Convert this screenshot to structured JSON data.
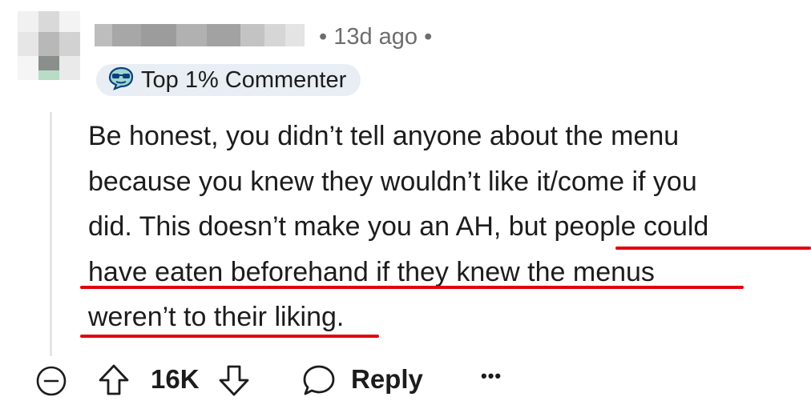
{
  "comment": {
    "timestamp": "13d ago",
    "meta_separator": "•",
    "flair": {
      "icon": "sunglasses-emoji-icon",
      "label": "Top 1% Commenter"
    },
    "body_lines": [
      "Be honest, you didn’t tell anyone about the menu",
      "because you knew they wouldn’t like it/come if you",
      "did. This doesn’t make you an AH, but people could",
      "have eaten beforehand if they knew the menus",
      "weren’t to their liking."
    ],
    "highlight_color": "#e3000f",
    "vote_count": "16K",
    "reply_label": "Reply",
    "more_label": "•••"
  }
}
